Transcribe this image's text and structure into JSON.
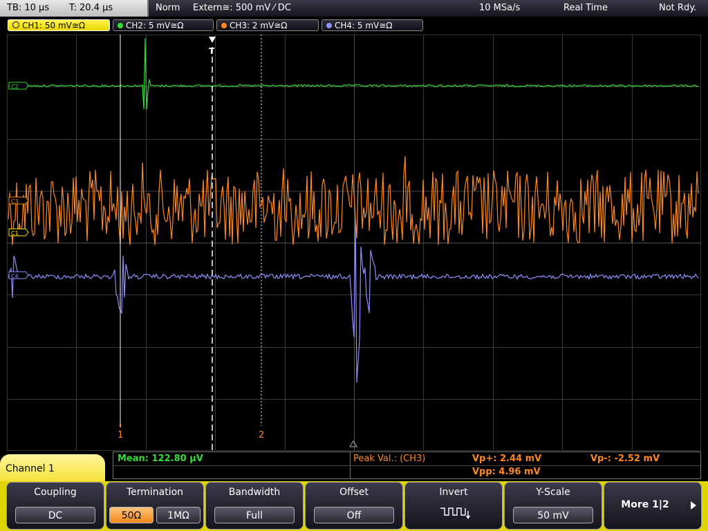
{
  "status": {
    "timebase": "TB: 10 µs",
    "trigger_time": "T: 20.4 µs",
    "mode": "Norm",
    "trigger_source": "Extern≅: 500 mV ⁄ DC",
    "sample_rate": "10 MSa/s",
    "acq_mode": "Real Time",
    "state": "Not Rdy."
  },
  "channels": [
    {
      "label": "CH1: 50 mV≅Ω",
      "color": "#ffee00",
      "active": true
    },
    {
      "label": "CH2: 5 mV≅Ω",
      "color": "#33dd33",
      "active": false
    },
    {
      "label": "CH3: 2 mV≅Ω",
      "color": "#ff8a1c",
      "active": false
    },
    {
      "label": "CH4: 5 mV≅Ω",
      "color": "#9090ff",
      "active": false
    }
  ],
  "markers": {
    "ch2": "C2",
    "ch3": "C3",
    "ch1": "C1",
    "ch4": "C4",
    "trigger": "T",
    "cursor1": "1",
    "cursor2": "2"
  },
  "measurements": {
    "mean": "Mean: 122.80 µV",
    "peak_label": "Peak Val.:  (CH3)",
    "vp_plus": "Vp+: 2.44 mV",
    "vp_minus": "Vp-: -2.52 mV",
    "vpp": "Vpp: 4.96 mV"
  },
  "menu": {
    "title": "Channel 1",
    "coupling": {
      "title": "Coupling",
      "value": "DC"
    },
    "termination": {
      "title": "Termination",
      "options": [
        "50Ω",
        "1MΩ"
      ],
      "selected": "50Ω"
    },
    "bandwidth": {
      "title": "Bandwidth",
      "value": "Full"
    },
    "offset": {
      "title": "Offset",
      "value": "Off"
    },
    "invert": {
      "title": "Invert"
    },
    "yscale": {
      "title": "Y-Scale",
      "value": "50 mV"
    },
    "more": {
      "label": "More 1|2"
    }
  }
}
